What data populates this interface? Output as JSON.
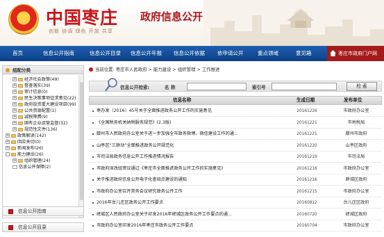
{
  "header": {
    "title": "中国枣庄",
    "slogan": "创新 协调 绿色 开放 共享",
    "subtitle": "政府信息公开"
  },
  "nav": {
    "items": [
      "首页",
      "信息公开指南",
      "信息公开目录",
      "信息公开年报",
      "信息公开依据",
      "依申请公开",
      "重点领域",
      "意见箱"
    ],
    "portal_label": "枣庄市政府门户网"
  },
  "sidebar": {
    "heading": "组配分类",
    "tree": [
      {
        "label": "经济社会政策(49)",
        "exp": "+"
      },
      {
        "label": "督查落实(39)",
        "exp": "+"
      },
      {
        "label": "审计信息(0)",
        "exp": "+"
      },
      {
        "label": "民生决策事项征求意见(22)",
        "exp": "+"
      },
      {
        "label": "政府投资重大建设项目(99)",
        "exp": "+"
      },
      {
        "label": "公共资源配置(1)",
        "exp": "+"
      },
      {
        "label": "减税降费(9)",
        "exp": "+"
      },
      {
        "label": "国有企业运营监管(32)",
        "exp": "+"
      },
      {
        "label": "规范性文件(136)",
        "exp": "+"
      },
      {
        "label": "政策解读(142)",
        "exp": "+"
      },
      {
        "label": "回应关切(0)",
        "exp": "+"
      },
      {
        "label": "新闻发布(26)",
        "exp": "+"
      },
      {
        "label": "能力建设(26)",
        "exp": "-"
      },
      {
        "label": "组织管理(24)",
        "exp": "+"
      },
      {
        "label": "信息公开保障(2)",
        "exp": ""
      }
    ],
    "buttons": [
      "信息公开指南",
      "信息公开目录"
    ]
  },
  "main": {
    "breadcrumb": "当前位置: 枣庄市人民政府 > 能力建设 > 组织管理 > 工作推进",
    "search": {
      "label": "信息公开检索:",
      "name_label": "名 称",
      "index_label": "索引号",
      "button": "检 索",
      "name_value": "",
      "index_value": ""
    },
    "columns": [
      "信息名称",
      "生成日期",
      "发布单位"
    ],
    "rows": [
      {
        "title": "枣办发〔2016〕45号关于全面推进政务公开工作的实施意见",
        "date": "20161226",
        "org": "市政府办公室"
      },
      {
        "title": "《全国税务机关纳税服务规范》(2.3版)",
        "date": "20161221",
        "org": "市地税局"
      },
      {
        "title": "滕州市人民政府办公室关于进一步加强全市政务微博、微信建设工作的通...",
        "date": "20161221",
        "org": "滕州市政府"
      },
      {
        "title": "山亭区“三联动”全面推进政务公开规范化",
        "date": "20161220",
        "org": "山亭区政府"
      },
      {
        "title": "市司法局政务信息公开工作推进情况报告",
        "date": "20161219",
        "org": "市司法局"
      },
      {
        "title": "市政府深改组审议通过《枣庄市全面推进政务公开工作的实施意见》",
        "date": "20161216",
        "org": "市政府办公室"
      },
      {
        "title": "关于推进政府信息公开电子化查阅点建设的通知",
        "date": "20161216",
        "org": "薛城区政府"
      },
      {
        "title": "市政府办公室召开常务会议研究政务公开工作",
        "date": "20161215",
        "org": "市政府办公室"
      },
      {
        "title": "2016年台儿庄区政务公开工作要点",
        "date": "20160812",
        "org": "台儿庄区政府"
      },
      {
        "title": "峄城区人民政府办公室关于印发2016年峄城区政务公开工作要点的通...",
        "date": "20160720",
        "org": "峄城区政府"
      },
      {
        "title": "市政府办公室印发2016年枣庄市政务公开工作要点",
        "date": "20160704",
        "org": "市政府办公室"
      }
    ]
  },
  "colors": {
    "brand_red": "#c8141a",
    "nav_blue": "#1e5fb0",
    "portal_red": "#a51a1a"
  }
}
